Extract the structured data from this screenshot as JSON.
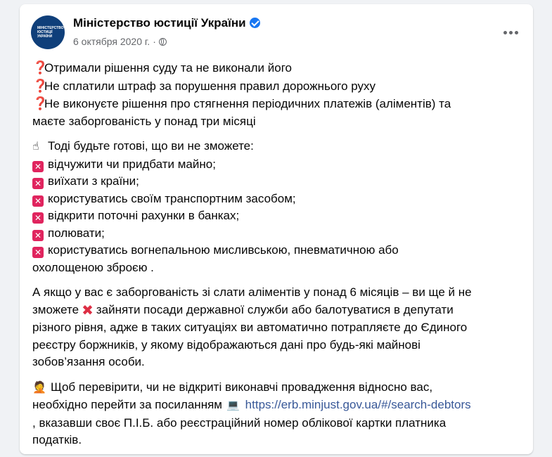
{
  "post": {
    "author": "Міністерство юстиції України",
    "date": "6 октября 2020 г.",
    "dot": "·",
    "avatar_text": "МІНІСТЕРСТВО ЮСТИЦІЇ УКРАЇНИ"
  },
  "icons": {
    "question": "❓",
    "finger": "☝",
    "cross": "✕",
    "cross_red": "✖",
    "face": "🤦",
    "laptop": "💻"
  },
  "intro_lines": [
    "Отримали рішення суду та не виконали його",
    "Не сплатили штраф за порушення правил дорожнього руху",
    "Не виконуєте рішення про стягнення періодичних платежів  (аліментів) та",
    "маєте заборгованість у понад три місяці"
  ],
  "restrictions": {
    "heading": "Тоді будьте готові, що ви не зможете:",
    "items": [
      "відчужити чи придбати майно;",
      "виїхати з країни;",
      "користуватись своїм транспортним засобом;",
      "відкрити поточні рахунки в банках;",
      "полювати;",
      "користуватись вогнепальною мисливською, пневматичною або"
    ],
    "continuation": "охолощеною зброєю ."
  },
  "alimony": {
    "line1": "А якщо у вас є заборгованість зі слати аліментів у понад 6 місяців – ви ще й не",
    "line2_a": "зможете",
    "line2_b": "зайняти посади державної служби або балотуватися в депутати",
    "line3": "різного рівня, адже в таких ситуаціях ви автоматично потрапляєте до Єдиного",
    "line4": "реєстру боржників, у якому  відображаються дані про будь-які майнові",
    "line5": "зобов’язання особи."
  },
  "check": {
    "line1": "Щоб перевірити, чи не відкриті виконавчі провадження відносно вас,",
    "line2": "необхідно перейти за посиланням",
    "link": "https://erb.minjust.gov.ua/#/search-debtors",
    "line3": ",  вказавши своє П.І.Б. або реєстраційний номер облікової картки платника",
    "line4": "податків."
  }
}
